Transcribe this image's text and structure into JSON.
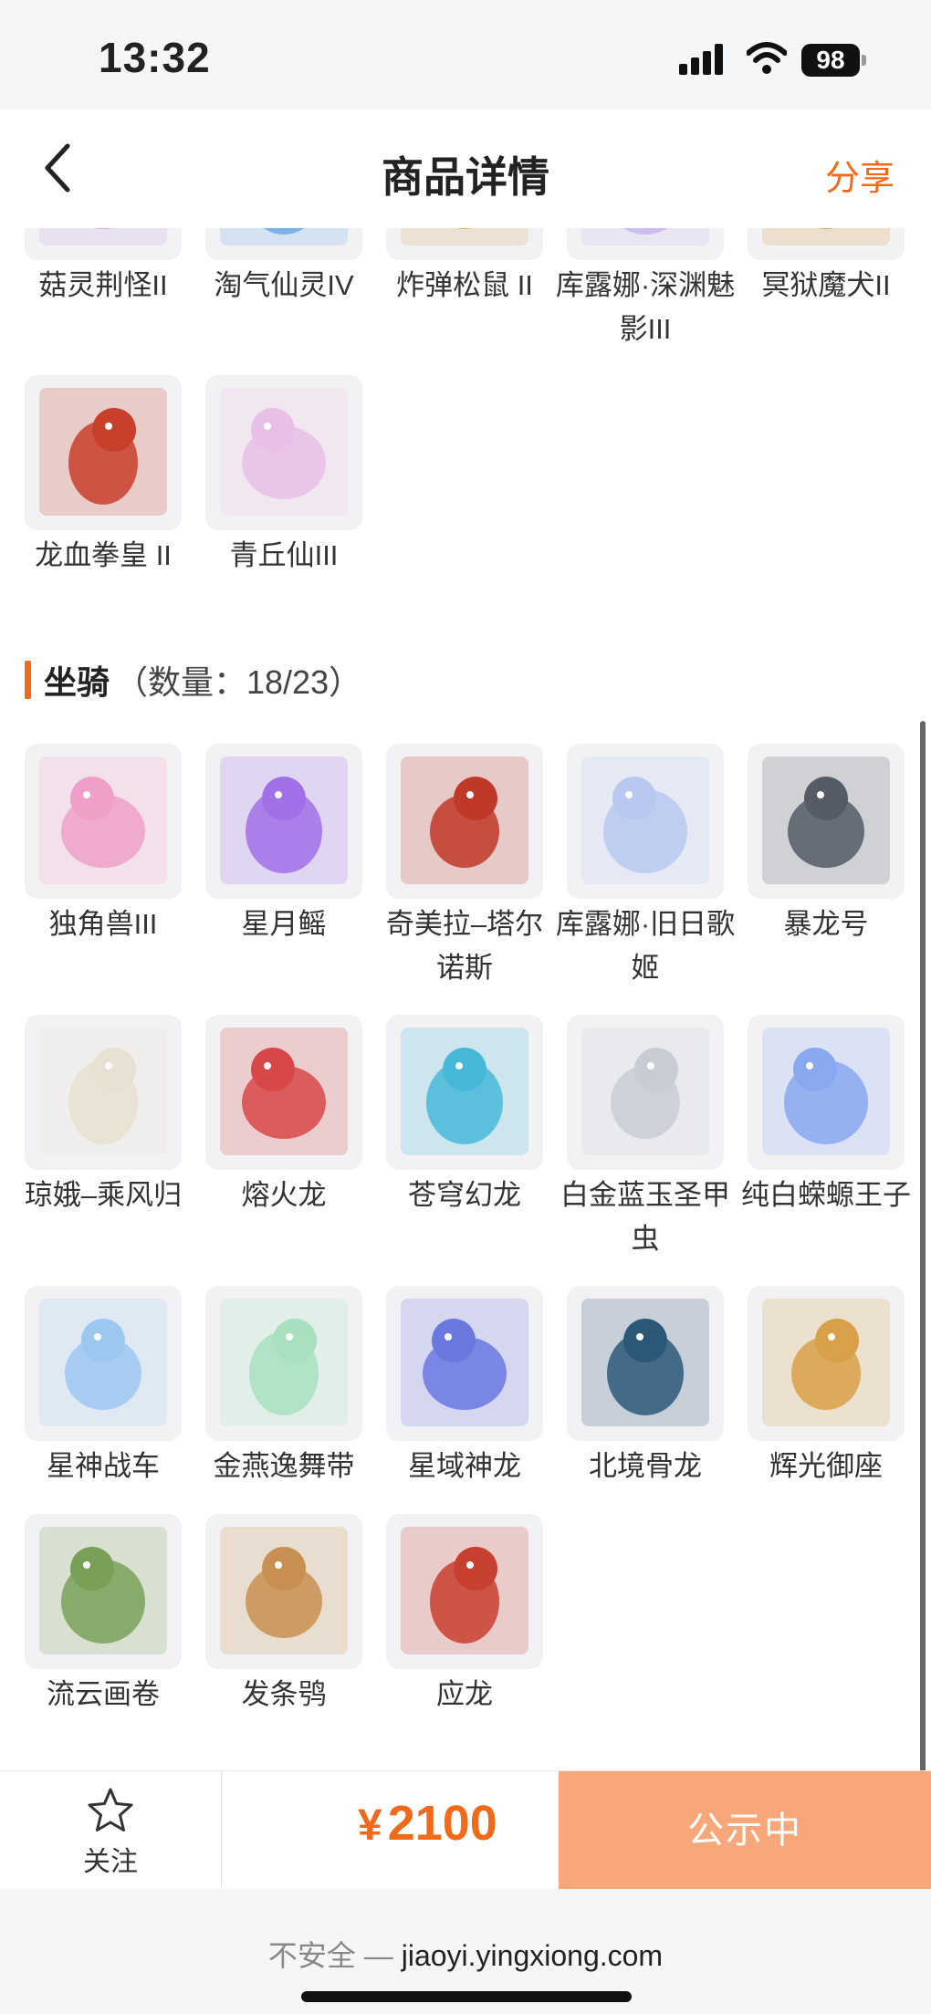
{
  "status_bar": {
    "time": "13:32",
    "battery": "98"
  },
  "nav": {
    "title": "商品详情",
    "share": "分享",
    "back_icon": "chevron-left-icon"
  },
  "skins_partial": [
    {
      "name": "菇灵荆怪II",
      "icon": "mushroom-monster-icon",
      "color": "#c9a6e0"
    },
    {
      "name": "淘气仙灵IV",
      "icon": "blue-sprite-icon",
      "color": "#6aa8e8"
    },
    {
      "name": "炸弹松鼠 II",
      "icon": "bomb-squirrel-icon",
      "color": "#d8a860"
    },
    {
      "name": "库露娜·深渊魅影III",
      "icon": "kuluna-abyss-icon",
      "color": "#c8b6ee"
    },
    {
      "name": "冥狱魔犬II",
      "icon": "hell-hound-icon",
      "color": "#d89c4a"
    },
    {
      "name": "龙血拳皇 II",
      "icon": "dragon-blood-boxer-icon",
      "color": "#c8402c"
    },
    {
      "name": "青丘仙III",
      "icon": "qingqiu-fairy-icon",
      "color": "#e8c0e6"
    }
  ],
  "mounts": {
    "title": "坐骑",
    "count_text": "（数量：18/23）",
    "items": [
      {
        "name": "独角兽III",
        "icon": "unicorn-icon",
        "color": "#f0a0c8"
      },
      {
        "name": "星月鳐",
        "icon": "star-ray-icon",
        "color": "#a070e8"
      },
      {
        "name": "奇美拉–塔尔诺斯",
        "icon": "chimera-icon",
        "color": "#c03828"
      },
      {
        "name": "库露娜·旧日歌姬",
        "icon": "kuluna-singer-icon",
        "color": "#b8c8f0"
      },
      {
        "name": "暴龙号",
        "icon": "mech-dragon-icon",
        "color": "#555c66"
      },
      {
        "name": "琼娥–乘风归",
        "icon": "moon-fairy-icon",
        "color": "#e8e0d0"
      },
      {
        "name": "熔火龙",
        "icon": "lava-dragon-icon",
        "color": "#d84848"
      },
      {
        "name": "苍穹幻龙",
        "icon": "sky-dragon-icon",
        "color": "#48b8d8"
      },
      {
        "name": "白金蓝玉圣甲虫",
        "icon": "scarab-icon",
        "color": "#c8ccd4"
      },
      {
        "name": "纯白蝾螈王子",
        "icon": "axolotl-prince-icon",
        "color": "#88a8f0"
      },
      {
        "name": "星神战车",
        "icon": "star-chariot-icon",
        "color": "#9cc8f0"
      },
      {
        "name": "金燕逸舞带",
        "icon": "golden-swallow-icon",
        "color": "#a8e0c0"
      },
      {
        "name": "星域神龙",
        "icon": "star-domain-dragon-icon",
        "color": "#6a78e0"
      },
      {
        "name": "北境骨龙",
        "icon": "bone-dragon-icon",
        "color": "#2c5878"
      },
      {
        "name": "辉光御座",
        "icon": "radiant-throne-icon",
        "color": "#d8a048"
      },
      {
        "name": "流云画卷",
        "icon": "bamboo-scroll-icon",
        "color": "#7aa058"
      },
      {
        "name": "发条鸮",
        "icon": "clockwork-owl-icon",
        "color": "#c89050"
      },
      {
        "name": "应龙",
        "icon": "yinglong-icon",
        "color": "#c84030"
      }
    ]
  },
  "bottom_bar": {
    "follow_label": "关注",
    "price_symbol": "¥",
    "price": "2100",
    "status_button": "公示中"
  },
  "url_bar": {
    "insecure_label": "不安全 —",
    "domain": "jiaoyi.yingxiong.com"
  }
}
